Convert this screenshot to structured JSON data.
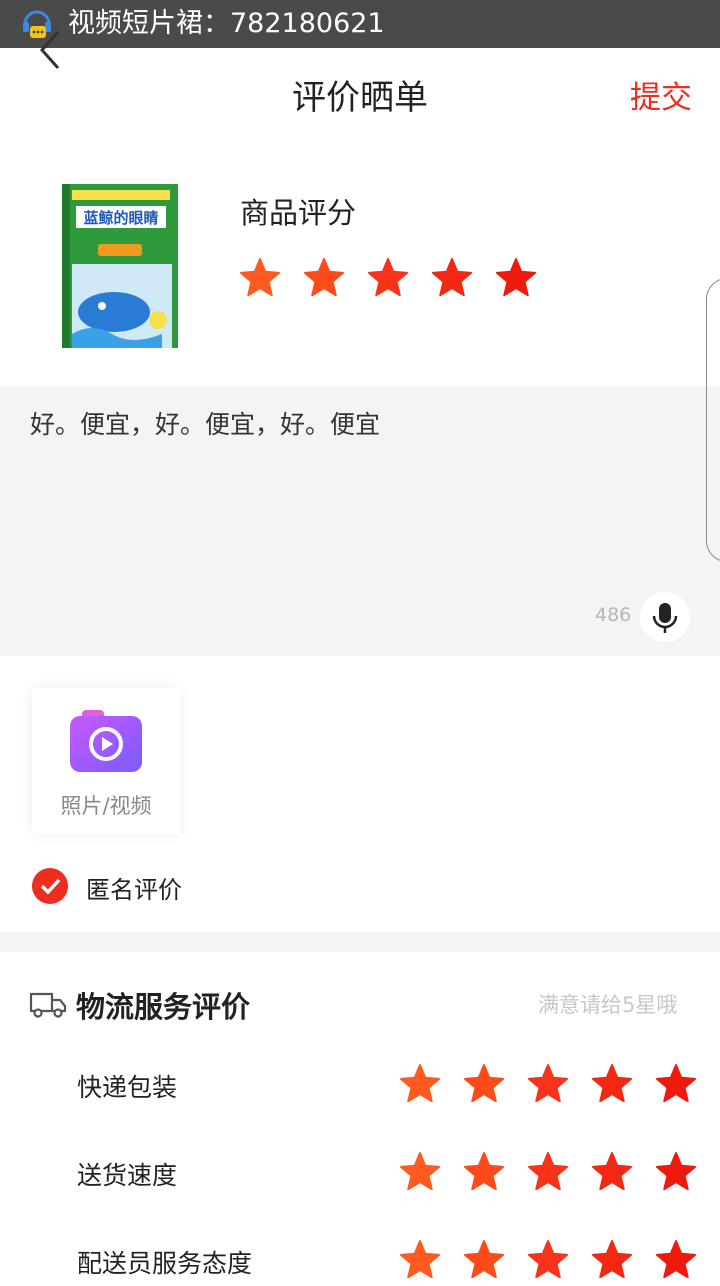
{
  "banner": {
    "text": "视频短片裙：782180621"
  },
  "nav": {
    "title": "评价晒单",
    "submit": "提交"
  },
  "product": {
    "cover_title": "蓝鲸的眼睛",
    "rating_label": "商品评分",
    "rating": 5
  },
  "comment": {
    "text": "好。便宜，好。便宜，好。便宜",
    "remaining": "486"
  },
  "upload": {
    "label": "照片/视频"
  },
  "anonymous": {
    "label": "匿名评价",
    "checked": true
  },
  "logistics": {
    "title": "物流服务评价",
    "hint": "满意请给5星哦",
    "rows": [
      {
        "label": "快递包装",
        "rating": 5
      },
      {
        "label": "送货速度",
        "rating": 5
      },
      {
        "label": "配送员服务态度",
        "rating": 5
      }
    ]
  },
  "colors": {
    "accent": "#ec2d1f",
    "star_gradient": [
      "#ff5a1f",
      "#ff4a1a",
      "#f8331a",
      "#f22812",
      "#ee1a0e"
    ],
    "banner_bg": "#4a4a4a"
  }
}
